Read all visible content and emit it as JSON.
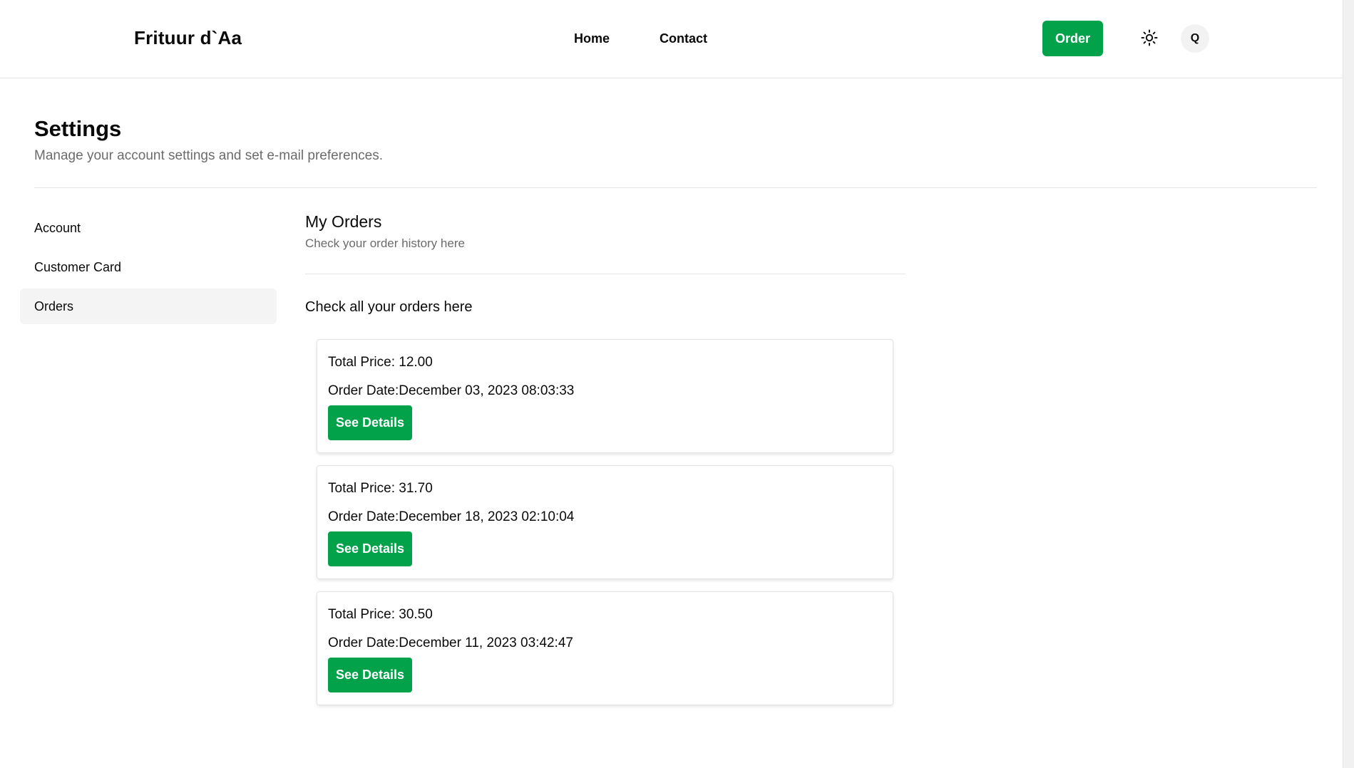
{
  "header": {
    "brand": "Frituur d`Aa",
    "nav": [
      {
        "label": "Home"
      },
      {
        "label": "Contact"
      }
    ],
    "order_label": "Order",
    "theme_icon": "sun-icon",
    "search_label": "Q"
  },
  "page": {
    "title": "Settings",
    "subtitle": "Manage your account settings and set e-mail preferences."
  },
  "sidebar": {
    "items": [
      {
        "label": "Account",
        "active": false
      },
      {
        "label": "Customer Card",
        "active": false
      },
      {
        "label": "Orders",
        "active": true
      }
    ]
  },
  "main": {
    "title": "My Orders",
    "subtitle": "Check your order history here",
    "intro": "Check all your orders here",
    "orders": [
      {
        "total": "Total Price: 12.00",
        "date": "Order Date:December 03, 2023 08:03:33",
        "button": "See Details"
      },
      {
        "total": "Total Price: 31.70",
        "date": "Order Date:December 18, 2023 02:10:04",
        "button": "See Details"
      },
      {
        "total": "Total Price: 30.50",
        "date": "Order Date:December 11, 2023 03:42:47",
        "button": "See Details"
      }
    ]
  },
  "colors": {
    "accent": "#02a24a",
    "muted_text": "#6b6b6b",
    "active_bg": "#f4f4f5"
  }
}
